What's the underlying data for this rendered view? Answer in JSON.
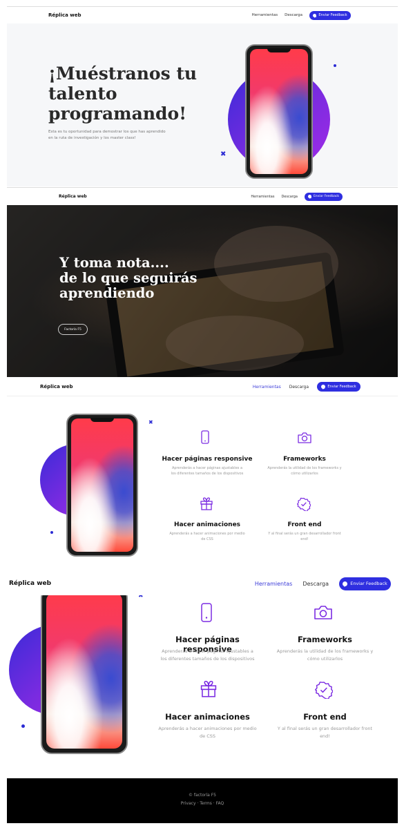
{
  "brand": "Réplica web",
  "nav": {
    "tools": "Herramientas",
    "download": "Descarga",
    "feedback": "Enviar Feedback"
  },
  "hero": {
    "title_l1": "¡Muéstranos tu",
    "title_l2": "talento",
    "title_l3": "programando!",
    "sub_l1": "Esta es tu oportunidad para demostrar los que has aprendido",
    "sub_l2": "en la ruta de investigación y los master class!"
  },
  "notes": {
    "title_l1": "Y toma nota....",
    "title_l2": "de lo que seguirás",
    "title_l3": "aprendiendo",
    "button": "Factoría F5"
  },
  "features": [
    {
      "icon": "smartphone-icon",
      "title": "Hacer páginas responsive",
      "desc_l1": "Aprenderás a hacer páginas ajustables a",
      "desc_l2": "los diferentes tamaños de los dispositivos"
    },
    {
      "icon": "camera-icon",
      "title": "Frameworks",
      "desc_l1": "Aprenderás la utilidad de los frameworks y",
      "desc_l2": "cómo utilizarlos"
    },
    {
      "icon": "gift-icon",
      "title": "Hacer animaciones",
      "desc_l1": "Aprenderás a hacer animaciones por medio",
      "desc_l2": "de CSS"
    },
    {
      "icon": "badge-check-icon",
      "title": "Front end",
      "desc_l1": "Y al final serás un gran desarrollador front",
      "desc_l2": "end!"
    }
  ],
  "footer": {
    "copy": "© factoría F5",
    "links": "Privacy · Terms · FAQ"
  },
  "colors": {
    "accent": "#2f2fe0",
    "purple": "#8a2be2",
    "link_active": "#3b3bd8"
  }
}
